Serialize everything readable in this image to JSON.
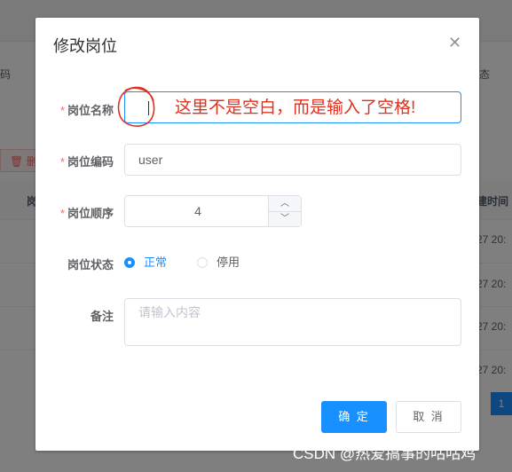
{
  "background": {
    "left_code_label": "码",
    "right_state_label": "态",
    "delete_button": "删",
    "column_left": "岗",
    "column_right": "建时间",
    "row_times": [
      "27 20:",
      "27 20:",
      "27 20:",
      "27 20:"
    ],
    "pagination_current": "1"
  },
  "dialog": {
    "title": "修改岗位",
    "close_icon": "close-icon",
    "fields": {
      "post_name": {
        "label": "岗位名称",
        "required": true,
        "value": ""
      },
      "post_code": {
        "label": "岗位编码",
        "required": true,
        "value": "user"
      },
      "post_sort": {
        "label": "岗位顺序",
        "required": true,
        "value": "4"
      },
      "status": {
        "label": "岗位状态",
        "options": [
          "正常",
          "停用"
        ],
        "selected": "正常"
      },
      "remark": {
        "label": "备注",
        "placeholder": "请输入内容",
        "value": ""
      }
    },
    "annotation": "这里不是空白，而是输入了空格!",
    "buttons": {
      "confirm": "确 定",
      "cancel": "取 消"
    }
  },
  "watermark": "CSDN @热爱搞事的咕咕鸡",
  "colors": {
    "primary": "#1890ff",
    "required": "#f56c6c",
    "annotation": "#e0301e"
  }
}
